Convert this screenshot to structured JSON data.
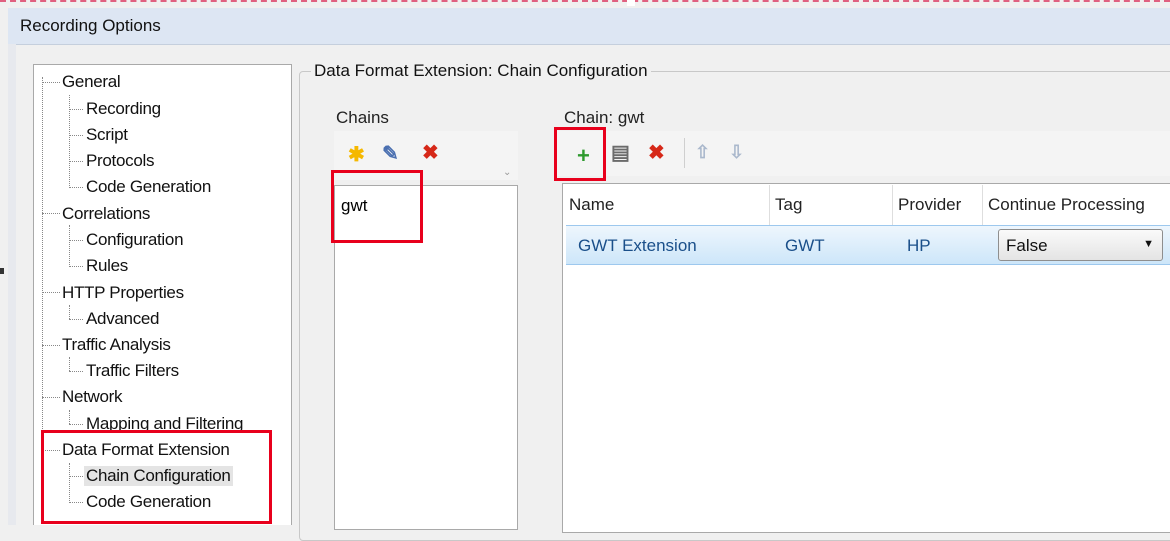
{
  "window": {
    "title": "Recording Options"
  },
  "tree": {
    "items": [
      {
        "label": "General",
        "level": 0
      },
      {
        "label": "Recording",
        "level": 1
      },
      {
        "label": "Script",
        "level": 1
      },
      {
        "label": "Protocols",
        "level": 1
      },
      {
        "label": "Code Generation",
        "level": 1
      },
      {
        "label": "Correlations",
        "level": 0
      },
      {
        "label": "Configuration",
        "level": 1
      },
      {
        "label": "Rules",
        "level": 1
      },
      {
        "label": "HTTP Properties",
        "level": 0
      },
      {
        "label": "Advanced",
        "level": 1
      },
      {
        "label": "Traffic Analysis",
        "level": 0
      },
      {
        "label": "Traffic Filters",
        "level": 1
      },
      {
        "label": "Network",
        "level": 0
      },
      {
        "label": "Mapping and Filtering",
        "level": 1
      },
      {
        "label": "Data Format Extension",
        "level": 0
      },
      {
        "label": "Chain Configuration",
        "level": 1,
        "selected": true
      },
      {
        "label": "Code Generation",
        "level": 1
      }
    ]
  },
  "panel": {
    "title": "Data Format Extension: Chain Configuration",
    "chains": {
      "label": "Chains",
      "items": [
        "gwt"
      ],
      "toolbar": {
        "new_icon": "new-star-icon",
        "edit_icon": "edit-icon",
        "delete_icon": "delete-icon"
      }
    },
    "chain_detail": {
      "label": "Chain: gwt",
      "toolbar": {
        "add_icon": "add-plus-icon",
        "properties_icon": "properties-icon",
        "delete_icon": "delete-icon",
        "up_icon": "arrow-up-icon",
        "down_icon": "arrow-down-icon"
      },
      "columns": [
        "Name",
        "Tag",
        "Provider",
        "Continue Processing"
      ],
      "rows": [
        {
          "name": "GWT Extension",
          "tag": "GWT",
          "provider": "HP",
          "continue_processing": "False"
        }
      ]
    }
  },
  "colors": {
    "highlight": "#e8001c",
    "selection": "#cde6f9",
    "link_text": "#1a4f8a"
  }
}
